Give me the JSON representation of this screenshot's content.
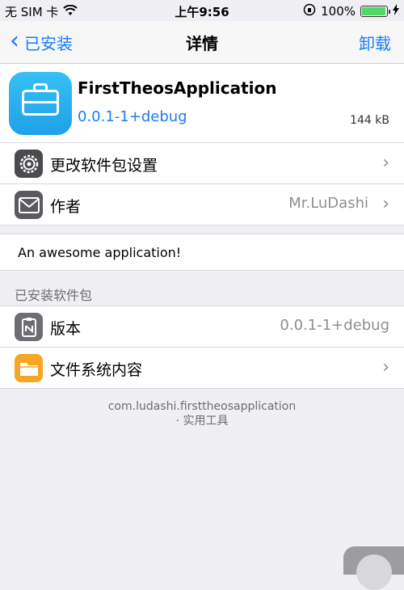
{
  "status_bar": {
    "carrier": "无 SIM 卡",
    "time": "上午9:56",
    "battery": "100%",
    "battery_level": 1.0
  },
  "navbar": {
    "back_label": "已安装",
    "title": "详情",
    "action_label": "卸载"
  },
  "package": {
    "name": "FirstTheosApplication",
    "version": "0.0.1-1+debug",
    "size": "144 kB",
    "icon": "toolbox-icon"
  },
  "rows_top": [
    {
      "label": "更改软件包设置",
      "value": "",
      "icon": "gear-icon"
    },
    {
      "label": "作者",
      "value": "Mr.LuDashi",
      "icon": "mail-icon"
    }
  ],
  "description": "An awesome application!",
  "section_title": "已安装软件包",
  "rows_bottom": [
    {
      "label": "版本",
      "value": "0.0.1-1+debug",
      "icon": "version-icon"
    },
    {
      "label": "文件系统内容",
      "value": "",
      "icon": "folder-icon"
    }
  ],
  "footer": {
    "identifier": "com.ludashi.firsttheosapplication",
    "category": "· 实用工具"
  },
  "colors": {
    "accent": "#1a7cf5",
    "background": "#efeff4",
    "battery_green": "#4cd964"
  }
}
